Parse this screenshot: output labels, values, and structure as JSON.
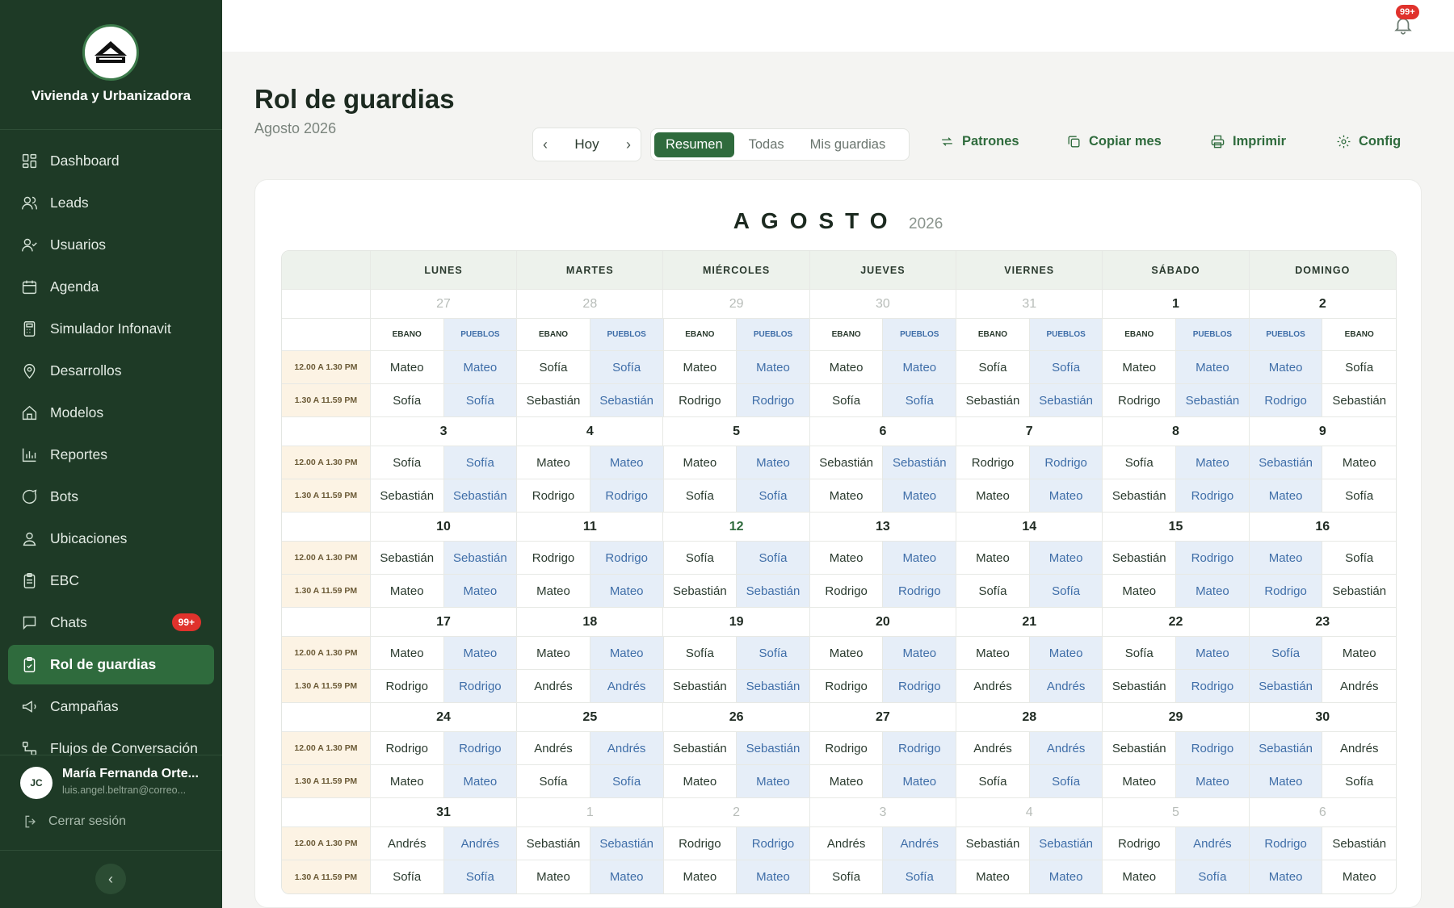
{
  "sidebar": {
    "brand": "Vivienda y Urbanizadora",
    "items": [
      {
        "label": "Dashboard",
        "icon": "dashboard-icon"
      },
      {
        "label": "Leads",
        "icon": "users-icon"
      },
      {
        "label": "Usuarios",
        "icon": "user-check-icon"
      },
      {
        "label": "Agenda",
        "icon": "calendar-icon"
      },
      {
        "label": "Simulador Infonavit",
        "icon": "calculator-icon"
      },
      {
        "label": "Desarrollos",
        "icon": "map-pin-icon"
      },
      {
        "label": "Modelos",
        "icon": "home-icon"
      },
      {
        "label": "Reportes",
        "icon": "bar-chart-icon"
      },
      {
        "label": "Bots",
        "icon": "chat-bubble-icon"
      },
      {
        "label": "Ubicaciones",
        "icon": "location-user-icon"
      },
      {
        "label": "EBC",
        "icon": "clipboard-icon"
      },
      {
        "label": "Chats",
        "icon": "message-icon",
        "badge": "99+"
      },
      {
        "label": "Rol de guardias",
        "icon": "clipboard-check-icon",
        "active": true
      },
      {
        "label": "Campañas",
        "icon": "megaphone-icon"
      },
      {
        "label": "Flujos de Conversación",
        "icon": "flow-icon"
      }
    ],
    "user": {
      "initials": "JC",
      "name": "María Fernanda Orte...",
      "email": "luis.angel.beltran@correo..."
    },
    "logout": "Cerrar sesión",
    "collapse": "‹"
  },
  "topbar": {
    "notif_badge": "99+"
  },
  "header": {
    "title": "Rol de guardias",
    "subtitle": "Agosto 2026"
  },
  "controls": {
    "prev": "‹",
    "today": "Hoy",
    "next": "›",
    "views": [
      "Resumen",
      "Todas",
      "Mis guardias"
    ],
    "patterns": "Patrones",
    "copy": "Copiar mes",
    "print": "Imprimir",
    "config": "Config"
  },
  "calendar": {
    "month": "AGOSTO",
    "year": "2026",
    "days": [
      "LUNES",
      "MARTES",
      "MIÉRCOLES",
      "JUEVES",
      "VIERNES",
      "SÁBADO",
      "DOMINGO"
    ],
    "locations_default": [
      "EBANO",
      "PUEBLOS"
    ],
    "locations_sunday": [
      "PUEBLOS",
      "EBANO"
    ],
    "shifts": [
      "12.00 A 1.30 PM",
      "1.30 A 11.59 PM"
    ],
    "weeks": [
      {
        "dates": [
          "27",
          "28",
          "29",
          "30",
          "31",
          "1",
          "2"
        ],
        "muted": [
          true,
          true,
          true,
          true,
          true,
          false,
          false
        ],
        "show_locations": true,
        "rows": [
          [
            "Mateo",
            "Mateo",
            "Sofía",
            "Sofía",
            "Mateo",
            "Mateo",
            "Mateo",
            "Mateo",
            "Sofía",
            "Sofía",
            "Mateo",
            "Mateo",
            "Mateo",
            "Sofía"
          ],
          [
            "Sofía",
            "Sofía",
            "Sebastián",
            "Sebastián",
            "Rodrigo",
            "Rodrigo",
            "Sofía",
            "Sofía",
            "Sebastián",
            "Sebastián",
            "Rodrigo",
            "Sebastián",
            "Rodrigo",
            "Sebastián"
          ]
        ]
      },
      {
        "dates": [
          "3",
          "4",
          "5",
          "6",
          "7",
          "8",
          "9"
        ],
        "muted": [
          false,
          false,
          false,
          false,
          false,
          false,
          false
        ],
        "rows": [
          [
            "Sofía",
            "Sofía",
            "Mateo",
            "Mateo",
            "Mateo",
            "Mateo",
            "Sebastián",
            "Sebastián",
            "Rodrigo",
            "Rodrigo",
            "Sofía",
            "Mateo",
            "Sebastián",
            "Mateo"
          ],
          [
            "Sebastián",
            "Sebastián",
            "Rodrigo",
            "Rodrigo",
            "Sofía",
            "Sofía",
            "Mateo",
            "Mateo",
            "Mateo",
            "Mateo",
            "Sebastián",
            "Rodrigo",
            "Mateo",
            "Sofía"
          ]
        ]
      },
      {
        "dates": [
          "10",
          "11",
          "12",
          "13",
          "14",
          "15",
          "16"
        ],
        "muted": [
          false,
          false,
          false,
          false,
          false,
          false,
          false
        ],
        "today_index": 2,
        "rows": [
          [
            "Sebastián",
            "Sebastián",
            "Rodrigo",
            "Rodrigo",
            "Sofía",
            "Sofía",
            "Mateo",
            "Mateo",
            "Mateo",
            "Mateo",
            "Sebastián",
            "Rodrigo",
            "Mateo",
            "Sofía"
          ],
          [
            "Mateo",
            "Mateo",
            "Mateo",
            "Mateo",
            "Sebastián",
            "Sebastián",
            "Rodrigo",
            "Rodrigo",
            "Sofía",
            "Sofía",
            "Mateo",
            "Mateo",
            "Rodrigo",
            "Sebastián"
          ]
        ]
      },
      {
        "dates": [
          "17",
          "18",
          "19",
          "20",
          "21",
          "22",
          "23"
        ],
        "muted": [
          false,
          false,
          false,
          false,
          false,
          false,
          false
        ],
        "rows": [
          [
            "Mateo",
            "Mateo",
            "Mateo",
            "Mateo",
            "Sofía",
            "Sofía",
            "Mateo",
            "Mateo",
            "Mateo",
            "Mateo",
            "Sofía",
            "Mateo",
            "Sofía",
            "Mateo"
          ],
          [
            "Rodrigo",
            "Rodrigo",
            "Andrés",
            "Andrés",
            "Sebastián",
            "Sebastián",
            "Rodrigo",
            "Rodrigo",
            "Andrés",
            "Andrés",
            "Sebastián",
            "Rodrigo",
            "Sebastián",
            "Andrés"
          ]
        ]
      },
      {
        "dates": [
          "24",
          "25",
          "26",
          "27",
          "28",
          "29",
          "30"
        ],
        "muted": [
          false,
          false,
          false,
          false,
          false,
          false,
          false
        ],
        "rows": [
          [
            "Rodrigo",
            "Rodrigo",
            "Andrés",
            "Andrés",
            "Sebastián",
            "Sebastián",
            "Rodrigo",
            "Rodrigo",
            "Andrés",
            "Andrés",
            "Sebastián",
            "Rodrigo",
            "Sebastián",
            "Andrés"
          ],
          [
            "Mateo",
            "Mateo",
            "Sofía",
            "Sofía",
            "Mateo",
            "Mateo",
            "Mateo",
            "Mateo",
            "Sofía",
            "Sofía",
            "Mateo",
            "Mateo",
            "Mateo",
            "Sofía"
          ]
        ]
      },
      {
        "dates": [
          "31",
          "1",
          "2",
          "3",
          "4",
          "5",
          "6"
        ],
        "muted": [
          false,
          true,
          true,
          true,
          true,
          true,
          true
        ],
        "rows": [
          [
            "Andrés",
            "Andrés",
            "Sebastián",
            "Sebastián",
            "Rodrigo",
            "Rodrigo",
            "Andrés",
            "Andrés",
            "Sebastián",
            "Sebastián",
            "Rodrigo",
            "Andrés",
            "Rodrigo",
            "Sebastián"
          ],
          [
            "Sofía",
            "Sofía",
            "Mateo",
            "Mateo",
            "Mateo",
            "Mateo",
            "Sofía",
            "Sofía",
            "Mateo",
            "Mateo",
            "Mateo",
            "Sofía",
            "Mateo",
            "Mateo"
          ]
        ]
      }
    ]
  }
}
